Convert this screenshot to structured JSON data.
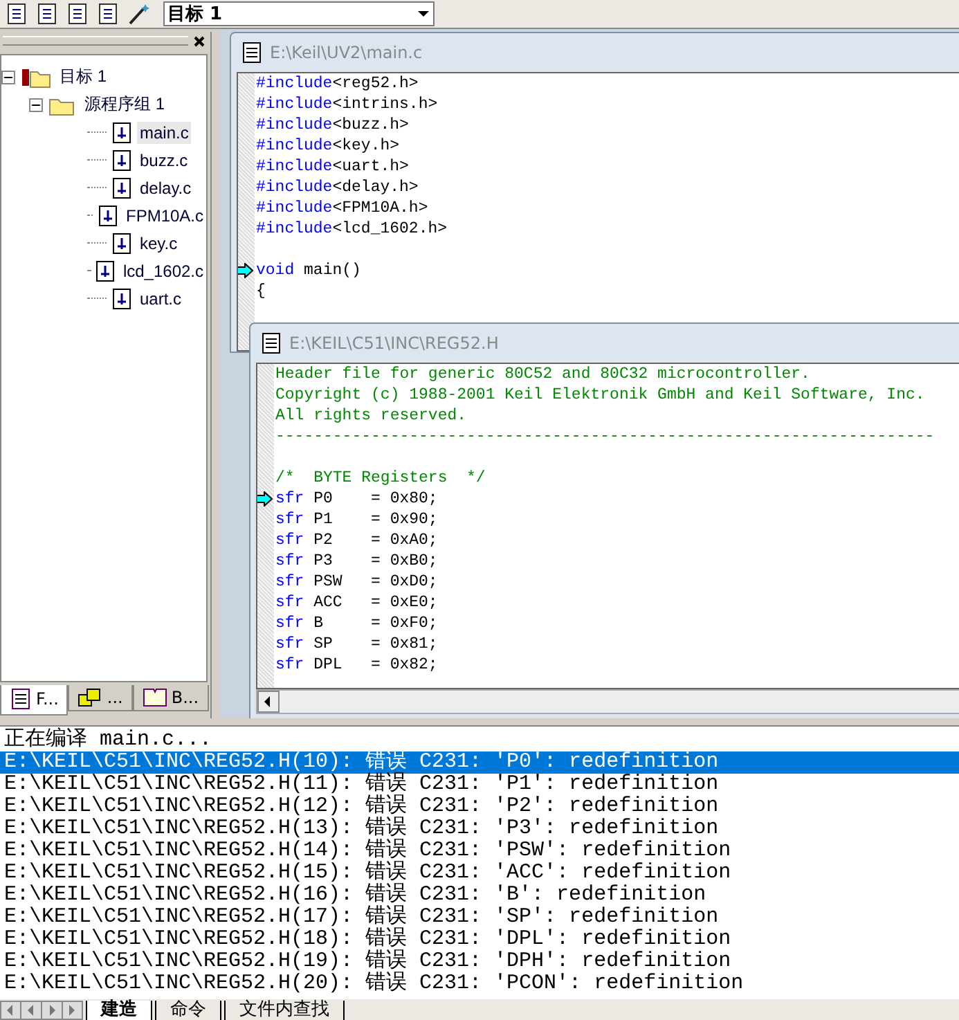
{
  "toolbar": {
    "target": "目标 1"
  },
  "project_panel": {
    "tree": [
      {
        "label": "目标 1",
        "expanded": true,
        "kind": "target",
        "selected": false,
        "children": [
          {
            "label": "源程序组 1",
            "expanded": true,
            "kind": "group",
            "selected": false,
            "children": [
              {
                "label": "main.c",
                "kind": "file",
                "selected": true
              },
              {
                "label": "buzz.c",
                "kind": "file",
                "selected": false
              },
              {
                "label": "delay.c",
                "kind": "file",
                "selected": false
              },
              {
                "label": "FPM10A.c",
                "kind": "file",
                "selected": false
              },
              {
                "label": "key.c",
                "kind": "file",
                "selected": false
              },
              {
                "label": "lcd_1602.c",
                "kind": "file",
                "selected": false
              },
              {
                "label": "uart.c",
                "kind": "file",
                "selected": false
              }
            ]
          }
        ]
      }
    ],
    "tabs": [
      {
        "label": "F...",
        "selected": true
      },
      {
        "label": "...",
        "selected": false
      },
      {
        "label": "B...",
        "selected": false
      }
    ]
  },
  "editors": [
    {
      "title": "E:\\Keil\\UV2\\main.c",
      "lines": [
        {
          "pointer": false,
          "parts": [
            {
              "text": "#include",
              "kind": "keyword"
            },
            {
              "text": "<reg52.h>",
              "kind": "plain"
            }
          ]
        },
        {
          "pointer": false,
          "parts": [
            {
              "text": "#include",
              "kind": "keyword"
            },
            {
              "text": "<intrins.h>",
              "kind": "plain"
            }
          ]
        },
        {
          "pointer": false,
          "parts": [
            {
              "text": "#include",
              "kind": "keyword"
            },
            {
              "text": "<buzz.h>",
              "kind": "plain"
            }
          ]
        },
        {
          "pointer": false,
          "parts": [
            {
              "text": "#include",
              "kind": "keyword"
            },
            {
              "text": "<key.h>",
              "kind": "plain"
            }
          ]
        },
        {
          "pointer": false,
          "parts": [
            {
              "text": "#include",
              "kind": "keyword"
            },
            {
              "text": "<uart.h>",
              "kind": "plain"
            }
          ]
        },
        {
          "pointer": false,
          "parts": [
            {
              "text": "#include",
              "kind": "keyword"
            },
            {
              "text": "<delay.h>",
              "kind": "plain"
            }
          ]
        },
        {
          "pointer": false,
          "parts": [
            {
              "text": "#include",
              "kind": "keyword"
            },
            {
              "text": "<FPM10A.h>",
              "kind": "plain"
            }
          ]
        },
        {
          "pointer": false,
          "parts": [
            {
              "text": "#include",
              "kind": "keyword"
            },
            {
              "text": "<lcd_1602.h>",
              "kind": "plain"
            }
          ]
        },
        {
          "pointer": false
        },
        {
          "pointer": true,
          "parts": [
            {
              "text": "void",
              "kind": "keyword"
            },
            {
              "text": " main()",
              "kind": "plain"
            }
          ]
        },
        {
          "pointer": false,
          "parts": [
            {
              "text": "{",
              "kind": "plain"
            }
          ]
        }
      ]
    },
    {
      "title": "E:\\KEIL\\C51\\INC\\REG52.H",
      "lines": [
        {
          "pointer": false,
          "parts": [
            {
              "text": "Header file for generic 80C52 and 80C32 microcontroller.",
              "kind": "comment"
            }
          ]
        },
        {
          "pointer": false,
          "parts": [
            {
              "text": "Copyright (c) 1988-2001 Keil Elektronik GmbH and Keil Software, Inc.",
              "kind": "comment"
            }
          ]
        },
        {
          "pointer": false,
          "parts": [
            {
              "text": "All rights reserved.",
              "kind": "comment"
            }
          ]
        },
        {
          "pointer": false,
          "parts": [
            {
              "text": "---------------------------------------------------------------------",
              "kind": "comment"
            }
          ]
        },
        {
          "pointer": false
        },
        {
          "pointer": false,
          "parts": [
            {
              "text": "/*  BYTE Registers  */",
              "kind": "comment"
            }
          ]
        },
        {
          "pointer": true,
          "parts": [
            {
              "text": "sfr",
              "kind": "keyword"
            },
            {
              "text": " P0    = 0x80;",
              "kind": "plain"
            }
          ]
        },
        {
          "pointer": false,
          "parts": [
            {
              "text": "sfr",
              "kind": "keyword"
            },
            {
              "text": " P1    = 0x90;",
              "kind": "plain"
            }
          ]
        },
        {
          "pointer": false,
          "parts": [
            {
              "text": "sfr",
              "kind": "keyword"
            },
            {
              "text": " P2    = 0xA0;",
              "kind": "plain"
            }
          ]
        },
        {
          "pointer": false,
          "parts": [
            {
              "text": "sfr",
              "kind": "keyword"
            },
            {
              "text": " P3    = 0xB0;",
              "kind": "plain"
            }
          ]
        },
        {
          "pointer": false,
          "parts": [
            {
              "text": "sfr",
              "kind": "keyword"
            },
            {
              "text": " PSW   = 0xD0;",
              "kind": "plain"
            }
          ]
        },
        {
          "pointer": false,
          "parts": [
            {
              "text": "sfr",
              "kind": "keyword"
            },
            {
              "text": " ACC   = 0xE0;",
              "kind": "plain"
            }
          ]
        },
        {
          "pointer": false,
          "parts": [
            {
              "text": "sfr",
              "kind": "keyword"
            },
            {
              "text": " B     = 0xF0;",
              "kind": "plain"
            }
          ]
        },
        {
          "pointer": false,
          "parts": [
            {
              "text": "sfr",
              "kind": "keyword"
            },
            {
              "text": " SP    = 0x81;",
              "kind": "plain"
            }
          ]
        },
        {
          "pointer": false,
          "parts": [
            {
              "text": "sfr",
              "kind": "keyword"
            },
            {
              "text": " DPL   = 0x82;",
              "kind": "plain"
            }
          ]
        }
      ]
    }
  ],
  "output": {
    "lines": [
      {
        "text": "正在编译 main.c...",
        "selected": false
      },
      {
        "text": "E:\\KEIL\\C51\\INC\\REG52.H(10): 错误 C231: 'P0': redefinition",
        "selected": true
      },
      {
        "text": "E:\\KEIL\\C51\\INC\\REG52.H(11): 错误 C231: 'P1': redefinition",
        "selected": false
      },
      {
        "text": "E:\\KEIL\\C51\\INC\\REG52.H(12): 错误 C231: 'P2': redefinition",
        "selected": false
      },
      {
        "text": "E:\\KEIL\\C51\\INC\\REG52.H(13): 错误 C231: 'P3': redefinition",
        "selected": false
      },
      {
        "text": "E:\\KEIL\\C51\\INC\\REG52.H(14): 错误 C231: 'PSW': redefinition",
        "selected": false
      },
      {
        "text": "E:\\KEIL\\C51\\INC\\REG52.H(15): 错误 C231: 'ACC': redefinition",
        "selected": false
      },
      {
        "text": "E:\\KEIL\\C51\\INC\\REG52.H(16): 错误 C231: 'B': redefinition",
        "selected": false
      },
      {
        "text": "E:\\KEIL\\C51\\INC\\REG52.H(17): 错误 C231: 'SP': redefinition",
        "selected": false
      },
      {
        "text": "E:\\KEIL\\C51\\INC\\REG52.H(18): 错误 C231: 'DPL': redefinition",
        "selected": false
      },
      {
        "text": "E:\\KEIL\\C51\\INC\\REG52.H(19): 错误 C231: 'DPH': redefinition",
        "selected": false
      },
      {
        "text": "E:\\KEIL\\C51\\INC\\REG52.H(20): 错误 C231: 'PCON': redefinition",
        "selected": false
      }
    ],
    "tabs": [
      {
        "label": "建造",
        "selected": true
      },
      {
        "label": "命令",
        "selected": false
      },
      {
        "label": "文件内查找",
        "selected": false
      }
    ]
  }
}
